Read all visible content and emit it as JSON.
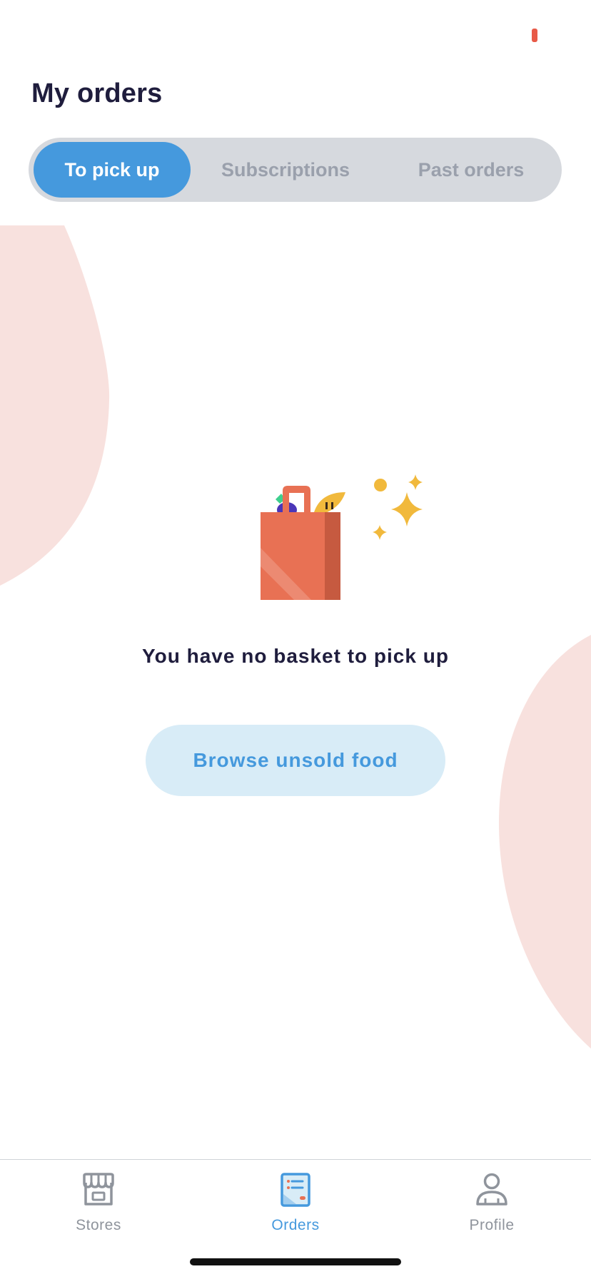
{
  "header": {
    "title": "My orders"
  },
  "tabs": [
    {
      "label": "To pick up",
      "active": true
    },
    {
      "label": "Subscriptions",
      "active": false
    },
    {
      "label": "Past orders",
      "active": false
    }
  ],
  "empty_state": {
    "illustration": "shopping-bag-sparkles",
    "message": "You have no basket to pick up",
    "action_label": "Browse unsold food"
  },
  "bottom_nav": {
    "items": [
      {
        "label": "Stores",
        "icon": "storefront-icon",
        "active": false
      },
      {
        "label": "Orders",
        "icon": "receipt-icon",
        "active": true
      },
      {
        "label": "Profile",
        "icon": "person-icon",
        "active": false
      }
    ]
  },
  "colors": {
    "accent": "#4599dd",
    "title": "#1f1d3d",
    "segment_bg": "#d6d9de",
    "button_bg": "#d8ecf7",
    "blob": "#f8e1de",
    "bag": "#e87154",
    "sparkle": "#f1b93c",
    "status_indicator": "#e85a48"
  }
}
